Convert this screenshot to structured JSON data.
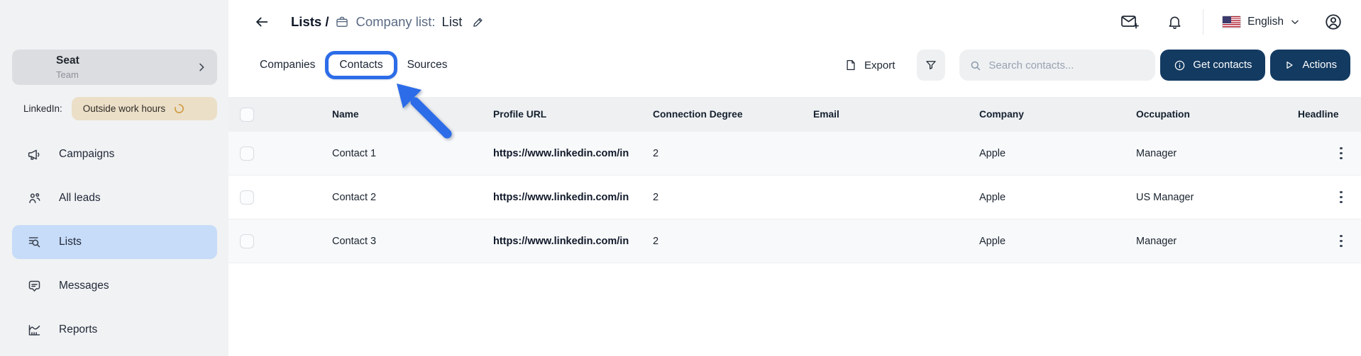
{
  "sidebar": {
    "seat": {
      "title": "Seat",
      "subtitle": "Team"
    },
    "linkedin": {
      "label": "LinkedIn:",
      "status": "Outside work hours"
    },
    "items": [
      {
        "label": "Campaigns"
      },
      {
        "label": "All leads"
      },
      {
        "label": "Lists"
      },
      {
        "label": "Messages"
      },
      {
        "label": "Reports"
      }
    ]
  },
  "header": {
    "breadcrumb_root": "Lists /",
    "list_type_label": "Company list:",
    "list_name": "List",
    "language": "English"
  },
  "tabs": [
    {
      "label": "Companies"
    },
    {
      "label": "Contacts"
    },
    {
      "label": "Sources"
    }
  ],
  "annotations": {
    "highlighted_tab": "Contacts"
  },
  "toolbar": {
    "export_label": "Export",
    "search_placeholder": "Search contacts...",
    "get_contacts_label": "Get contacts",
    "actions_label": "Actions"
  },
  "table": {
    "columns": [
      "Name",
      "Profile URL",
      "Connection Degree",
      "Email",
      "Company",
      "Occupation",
      "Headline"
    ],
    "rows": [
      {
        "name": "Contact 1",
        "profile_url": "https://www.linkedin.com/in",
        "connection_degree": "2",
        "email": "",
        "company": "Apple",
        "occupation": "Manager",
        "headline": ""
      },
      {
        "name": "Contact 2",
        "profile_url": "https://www.linkedin.com/in",
        "connection_degree": "2",
        "email": "",
        "company": "Apple",
        "occupation": "US Manager",
        "headline": ""
      },
      {
        "name": "Contact 3",
        "profile_url": "https://www.linkedin.com/in",
        "connection_degree": "2",
        "email": "",
        "company": "Apple",
        "occupation": "Manager",
        "headline": ""
      }
    ]
  },
  "colors": {
    "accent": "#2c6ce8",
    "navy": "#133a61",
    "sidebar_bg": "#f1f2f3",
    "badge_bg": "#ecdfc8",
    "active_bg": "#c7dcf8",
    "header_bg": "#eef0f2",
    "row_alt": "#f8f9fa",
    "spinner": "#cf9a3e"
  }
}
